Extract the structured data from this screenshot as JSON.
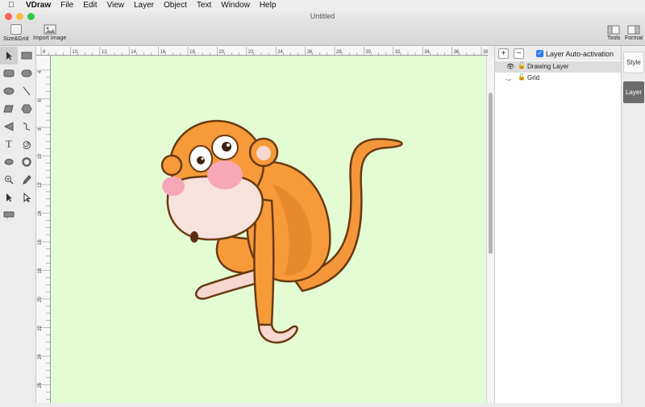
{
  "menubar": {
    "app": "VDraw",
    "items": [
      "File",
      "Edit",
      "View",
      "Layer",
      "Object",
      "Text",
      "Window",
      "Help"
    ]
  },
  "window": {
    "title": "Untitled",
    "traffic_colors": [
      "#fc605c",
      "#fdbc40",
      "#34c84a"
    ]
  },
  "toolbar": {
    "size_grid_label": "Size&Grid",
    "import_image_label": "Import Image",
    "tools_label": "Tools",
    "format_label": "Format"
  },
  "tool_icons": [
    "select-arrow-icon",
    "rectangle-icon",
    "rounded-rect-icon",
    "rounded-rect2-icon",
    "ellipse-icon",
    "line-icon",
    "parallelogram-icon",
    "hexagon-icon",
    "triangle-icon",
    "curve-icon",
    "text-icon",
    "spiral-icon",
    "blob-icon",
    "ring-icon",
    "zoom-icon",
    "pencil-icon",
    "direct-select-icon",
    "node-select-icon",
    "comment-icon"
  ],
  "ruler": {
    "top_labels": [
      "8",
      "10",
      "12",
      "14",
      "16",
      "18",
      "20",
      "22",
      "24",
      "26",
      "28",
      "30",
      "32",
      "34",
      "36",
      "38"
    ],
    "left_labels": [
      "4",
      "6",
      "8",
      "10",
      "12",
      "14",
      "16",
      "18",
      "20",
      "22",
      "24",
      "26"
    ]
  },
  "canvas": {
    "background": "#e3fcd3"
  },
  "layers": {
    "auto_activation_label": "Layer Auto-activation",
    "auto_activation_checked": true,
    "add": "+",
    "remove": "−",
    "items": [
      {
        "name": "Drawing Layer",
        "active": true
      },
      {
        "name": "Grid",
        "active": false
      }
    ]
  },
  "sidetabs": {
    "style": "Style",
    "layer": "Layer"
  },
  "colors": {
    "accent": "#2f7ef6",
    "canvas": "#e3fcd3",
    "monkey_orange": "#f79a3a",
    "monkey_face": "#f7e3dc"
  }
}
